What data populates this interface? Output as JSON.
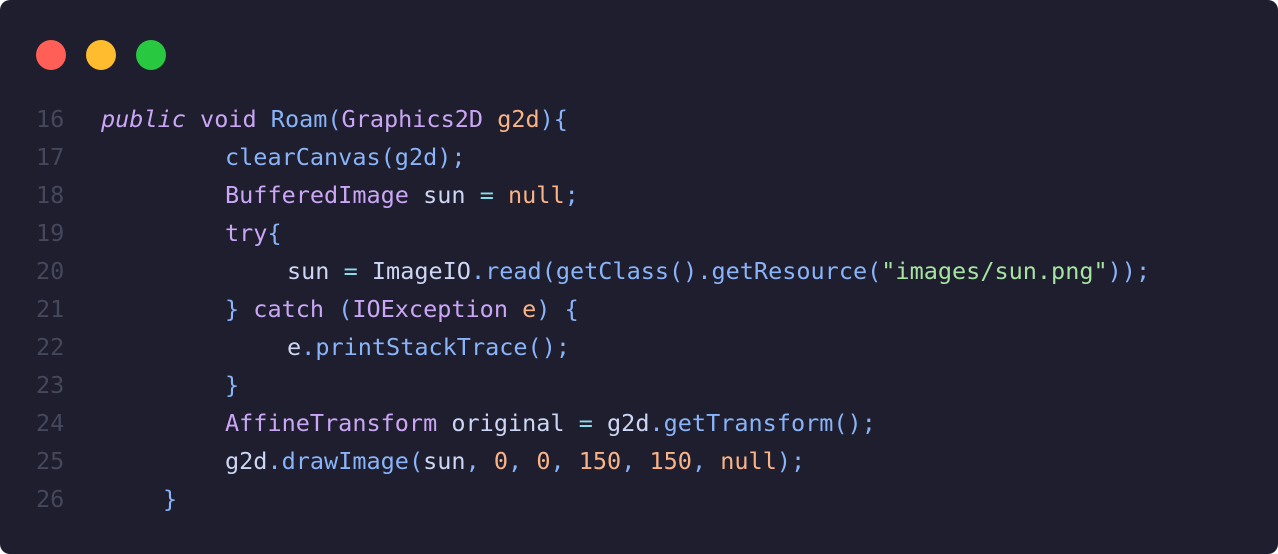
{
  "window": {
    "background": "#1e1e2e",
    "buttons": [
      {
        "name": "close",
        "color": "#ff5f57"
      },
      {
        "name": "minimize",
        "color": "#febc2e"
      },
      {
        "name": "zoom",
        "color": "#28c840"
      }
    ]
  },
  "colors": {
    "linenumber": "#45475a",
    "plain": "#cdd6f4",
    "keyword": "#cba6f7",
    "type": "#cba6f7",
    "func": "#89b4fa",
    "punct": "#89b4fa",
    "param": "#fab387",
    "number": "#fab387",
    "string": "#a6e3a1",
    "operator": "#89dceb"
  },
  "code": {
    "lines": [
      {
        "n": "16",
        "indent": 0,
        "tokens": [
          {
            "t": "public",
            "k": "keyword",
            "italic": true
          },
          {
            "t": " ",
            "k": "plain"
          },
          {
            "t": "void",
            "k": "keyword"
          },
          {
            "t": " ",
            "k": "plain"
          },
          {
            "t": "Roam",
            "k": "func"
          },
          {
            "t": "(",
            "k": "punct"
          },
          {
            "t": "Graphics2D",
            "k": "keyword"
          },
          {
            "t": " ",
            "k": "plain"
          },
          {
            "t": "g2d",
            "k": "param"
          },
          {
            "t": "){",
            "k": "punct"
          }
        ]
      },
      {
        "n": "17",
        "indent": 2,
        "tokens": [
          {
            "t": "clearCanvas",
            "k": "func"
          },
          {
            "t": "(",
            "k": "punct"
          },
          {
            "t": "g2d",
            "k": "func"
          },
          {
            "t": ");",
            "k": "punct"
          }
        ]
      },
      {
        "n": "18",
        "indent": 2,
        "tokens": [
          {
            "t": "BufferedImage",
            "k": "type"
          },
          {
            "t": " sun ",
            "k": "plain"
          },
          {
            "t": "=",
            "k": "operator"
          },
          {
            "t": " ",
            "k": "plain"
          },
          {
            "t": "null",
            "k": "number"
          },
          {
            "t": ";",
            "k": "punct"
          }
        ]
      },
      {
        "n": "19",
        "indent": 2,
        "tokens": [
          {
            "t": "try",
            "k": "keyword"
          },
          {
            "t": "{",
            "k": "punct"
          }
        ]
      },
      {
        "n": "20",
        "indent": 3,
        "tokens": [
          {
            "t": "sun ",
            "k": "plain"
          },
          {
            "t": "=",
            "k": "operator"
          },
          {
            "t": " ImageIO",
            "k": "plain"
          },
          {
            "t": ".",
            "k": "punct"
          },
          {
            "t": "read",
            "k": "func"
          },
          {
            "t": "(",
            "k": "punct"
          },
          {
            "t": "getClass",
            "k": "func"
          },
          {
            "t": "().",
            "k": "punct"
          },
          {
            "t": "getResource",
            "k": "func"
          },
          {
            "t": "(",
            "k": "punct"
          },
          {
            "t": "\"images/sun.png\"",
            "k": "string"
          },
          {
            "t": "));",
            "k": "punct"
          }
        ]
      },
      {
        "n": "21",
        "indent": 2,
        "tokens": [
          {
            "t": "} ",
            "k": "punct"
          },
          {
            "t": "catch",
            "k": "keyword"
          },
          {
            "t": " (",
            "k": "punct"
          },
          {
            "t": "IOException",
            "k": "type"
          },
          {
            "t": " ",
            "k": "plain"
          },
          {
            "t": "e",
            "k": "param"
          },
          {
            "t": ") {",
            "k": "punct"
          }
        ]
      },
      {
        "n": "22",
        "indent": 3,
        "tokens": [
          {
            "t": "e",
            "k": "plain"
          },
          {
            "t": ".",
            "k": "punct"
          },
          {
            "t": "printStackTrace",
            "k": "func"
          },
          {
            "t": "();",
            "k": "punct"
          }
        ]
      },
      {
        "n": "23",
        "indent": 2,
        "tokens": [
          {
            "t": "}",
            "k": "punct"
          }
        ]
      },
      {
        "n": "24",
        "indent": 2,
        "tokens": [
          {
            "t": "AffineTransform",
            "k": "type"
          },
          {
            "t": " original ",
            "k": "plain"
          },
          {
            "t": "=",
            "k": "operator"
          },
          {
            "t": " g2d",
            "k": "plain"
          },
          {
            "t": ".",
            "k": "punct"
          },
          {
            "t": "getTransform",
            "k": "func"
          },
          {
            "t": "();",
            "k": "punct"
          }
        ]
      },
      {
        "n": "25",
        "indent": 2,
        "tokens": [
          {
            "t": "g2d",
            "k": "plain"
          },
          {
            "t": ".",
            "k": "punct"
          },
          {
            "t": "drawImage",
            "k": "func"
          },
          {
            "t": "(",
            "k": "punct"
          },
          {
            "t": "sun",
            "k": "plain"
          },
          {
            "t": ", ",
            "k": "punct"
          },
          {
            "t": "0",
            "k": "number"
          },
          {
            "t": ", ",
            "k": "punct"
          },
          {
            "t": "0",
            "k": "number"
          },
          {
            "t": ", ",
            "k": "punct"
          },
          {
            "t": "150",
            "k": "number"
          },
          {
            "t": ", ",
            "k": "punct"
          },
          {
            "t": "150",
            "k": "number"
          },
          {
            "t": ", ",
            "k": "punct"
          },
          {
            "t": "null",
            "k": "number"
          },
          {
            "t": ");",
            "k": "punct"
          }
        ]
      },
      {
        "n": "26",
        "indent": 1,
        "tokens": [
          {
            "t": "}",
            "k": "punct"
          }
        ]
      }
    ]
  }
}
